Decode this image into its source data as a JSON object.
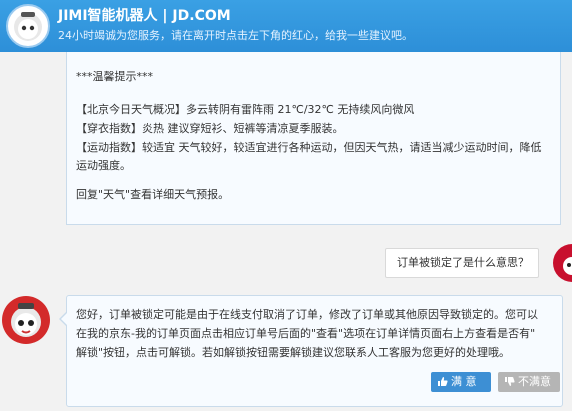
{
  "header": {
    "title": "JIMI智能机器人 | JD.COM",
    "subtitle": "24小时竭诚为您服务，请在离开时点击左下角的红心，给我一些建议吧。"
  },
  "weather_message": {
    "lines": [
      "***温馨提示***",
      "【北京今日天气概况】多云转阴有雷阵雨 21℃/32℃ 无持续风向微风",
      "【穿衣指数】炎热 建议穿短衫、短裤等清凉夏季服装。",
      "【运动指数】较适宜 天气较好，较适宜进行各种运动，但因天气热，请适当减少运动时间，降低",
      "运动强度。",
      "回复\"天气\"查看详细天气预报。"
    ]
  },
  "user_message": {
    "text": "订单被锁定了是什么意思？"
  },
  "robot_reply": {
    "lines": [
      "您好，订单被锁定可能是由于在线支付取消了订单，修改了订单或其他原因导致锁定的。您可以",
      "在我的京东-我的订单页面点击相应订单号后面的\"查看\"选项在订单详情页面右上方查看是否有\"",
      "解锁\"按钮，点击可解锁。若如解锁按钮需要解锁建议您联系人工客服为您更好的处理哦。"
    ]
  },
  "feedback": {
    "satisfied": "满 意",
    "unsatisfied": "不满意"
  },
  "colors": {
    "header": "#2d8fd8",
    "satisfied": "#3d8fd4",
    "unsatisfied": "#b5b5b5",
    "avatar_red": "#d32a2a"
  }
}
